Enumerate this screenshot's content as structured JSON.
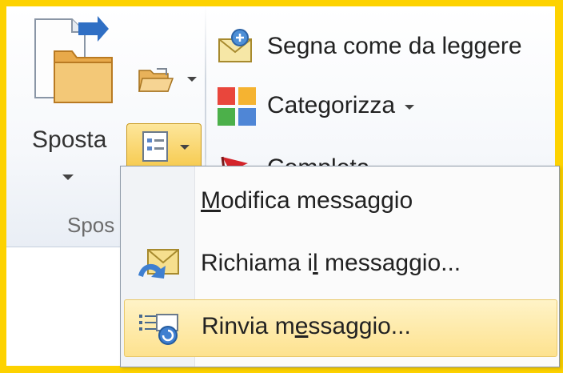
{
  "ribbon": {
    "move_button_label": "Sposta",
    "group_label": "Spos",
    "mark_unread_label": "Segna come da leggere",
    "categorize_label": "Categorizza",
    "followup_label": "Completa"
  },
  "menu": {
    "items": [
      {
        "pre": "",
        "accel": "M",
        "post": "odifica messaggio",
        "highlighted": false
      },
      {
        "pre": "Richiama i",
        "accel": "l",
        "post": " messaggio...",
        "highlighted": false
      },
      {
        "pre": "Rinvia m",
        "accel": "e",
        "post": "ssaggio...",
        "highlighted": true
      }
    ]
  },
  "colors": {
    "outer_border": "#fdd200",
    "highlight": "#fde28f",
    "active_button": "#f8d66a"
  },
  "icons": [
    "move-doc-icon",
    "folder-open-icon",
    "actions-icon",
    "mark-unread-icon",
    "categorize-icon",
    "flag-icon",
    "edit-message-icon",
    "recall-message-icon",
    "resend-message-icon"
  ]
}
